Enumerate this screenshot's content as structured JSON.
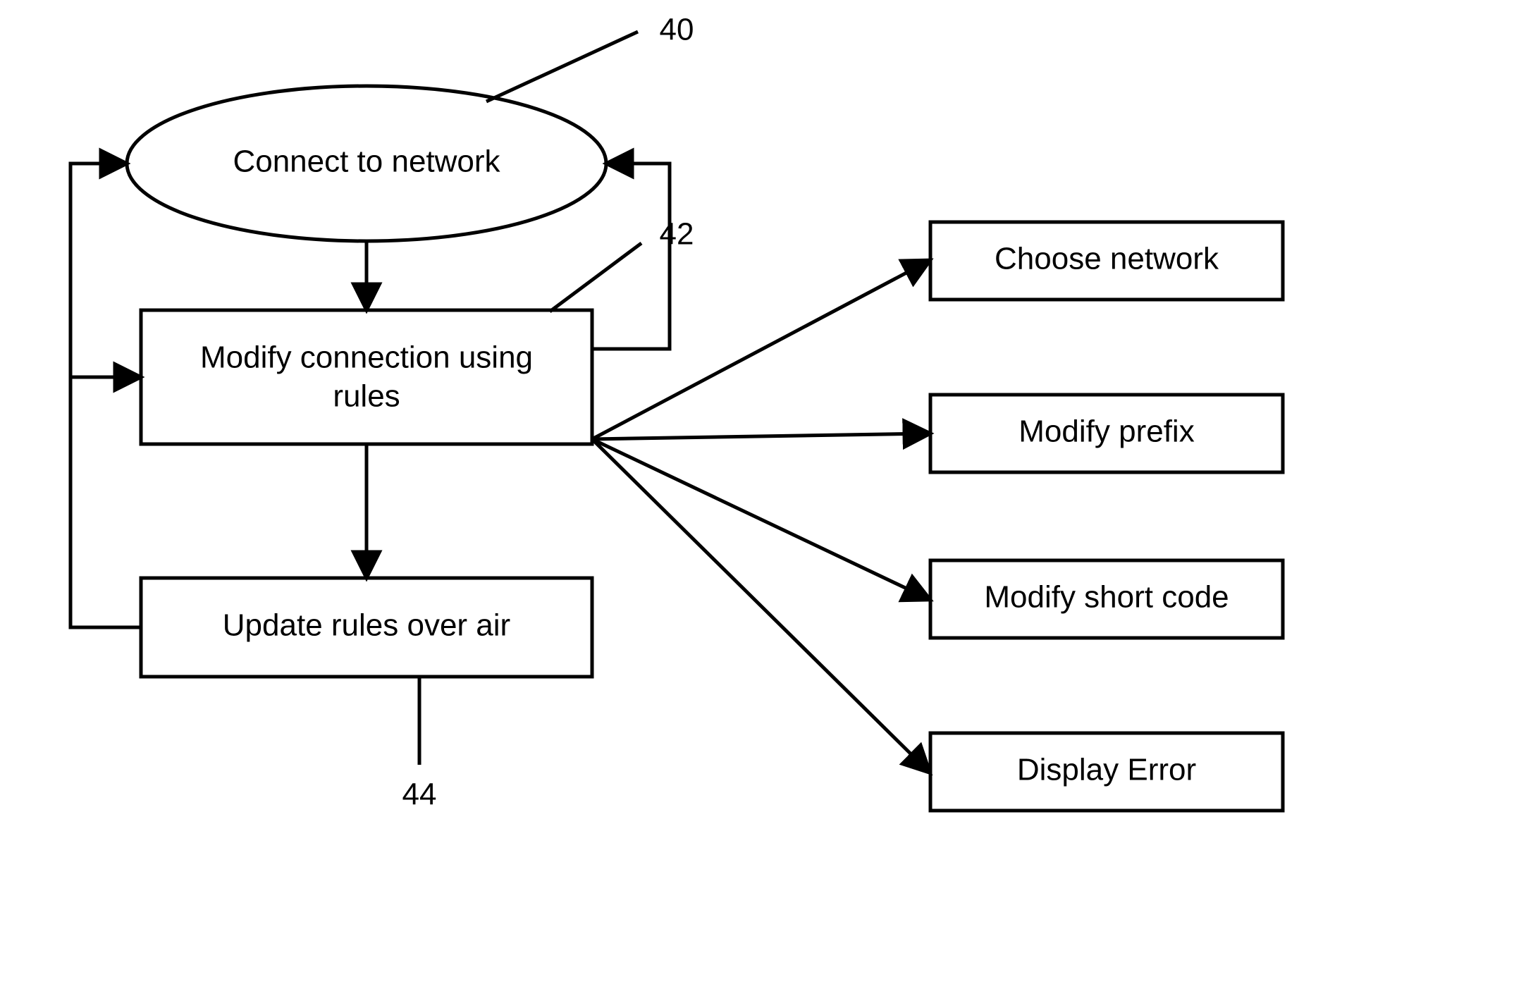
{
  "diagram": {
    "nodes": {
      "connect": {
        "label": "Connect to network",
        "ref": "40"
      },
      "modify": {
        "label_line1": "Modify connection using",
        "label_line2": "rules",
        "ref": "42"
      },
      "update": {
        "label": "Update rules over air",
        "ref": "44"
      },
      "choose": {
        "label": "Choose network"
      },
      "prefix": {
        "label": "Modify prefix"
      },
      "shortcode": {
        "label": "Modify short code"
      },
      "error": {
        "label": "Display Error"
      }
    }
  }
}
